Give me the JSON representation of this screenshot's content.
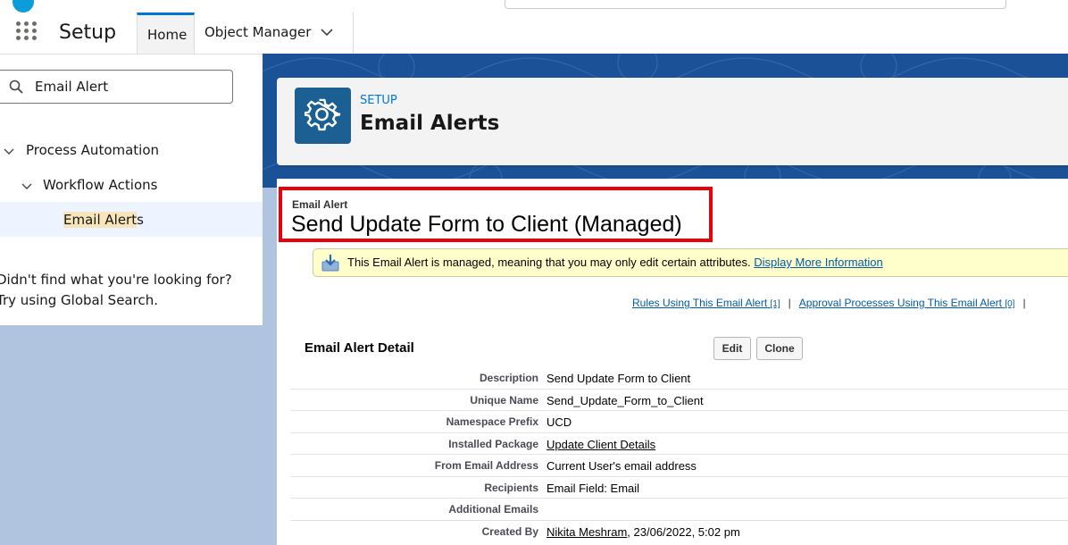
{
  "nav": {
    "app_title": "Setup",
    "tabs": [
      {
        "label": "Home"
      },
      {
        "label": "Object Manager"
      }
    ]
  },
  "sidebar": {
    "quick_find_value": "Email Alert",
    "tree": [
      {
        "label": "Process Automation"
      },
      {
        "label": "Workflow Actions"
      }
    ],
    "selected": {
      "label_highlight": "Email Alert",
      "label_rest": "s"
    },
    "not_found_text": "Didn't find what you're looking for? Try using Global Search."
  },
  "header": {
    "eyebrow": "SETUP",
    "title": "Email Alerts",
    "icon": "gear-icon"
  },
  "record": {
    "type_label": "Email Alert",
    "name": "Send Update Form to Client (Managed)",
    "info_message": "This Email Alert is managed, meaning that you may only edit certain attributes.",
    "info_link": "Display More Information"
  },
  "related_links": [
    {
      "label": "Rules Using This Email Alert",
      "count": "[1]"
    },
    {
      "label": "Approval Processes Using This Email Alert",
      "count": "[0]"
    }
  ],
  "detail": {
    "section_title": "Email Alert Detail",
    "edit_button": "Edit",
    "clone_button": "Clone",
    "rows": [
      {
        "label": "Description",
        "value": "Send Update Form to Client"
      },
      {
        "label": "Unique Name",
        "value": "Send_Update_Form_to_Client"
      },
      {
        "label": "Namespace Prefix",
        "value": "UCD"
      },
      {
        "label": "Installed Package",
        "value": "Update Client Details",
        "link": true
      },
      {
        "label": "From Email Address",
        "value": "Current User's email address"
      },
      {
        "label": "Recipients",
        "value": "Email Field: Email"
      },
      {
        "label": "Additional Emails",
        "value": ""
      },
      {
        "label": "Created By",
        "value_link": "Nikita Meshram",
        "value_suffix": ", 23/06/2022, 5:02 pm"
      }
    ]
  },
  "colors": {
    "brand_blue": "#0176d3",
    "banner_blue": "#1b5297",
    "header_icon_bg": "#1b5f93",
    "highlight_box": "#e8000b",
    "info_bg": "#ffffcc"
  }
}
